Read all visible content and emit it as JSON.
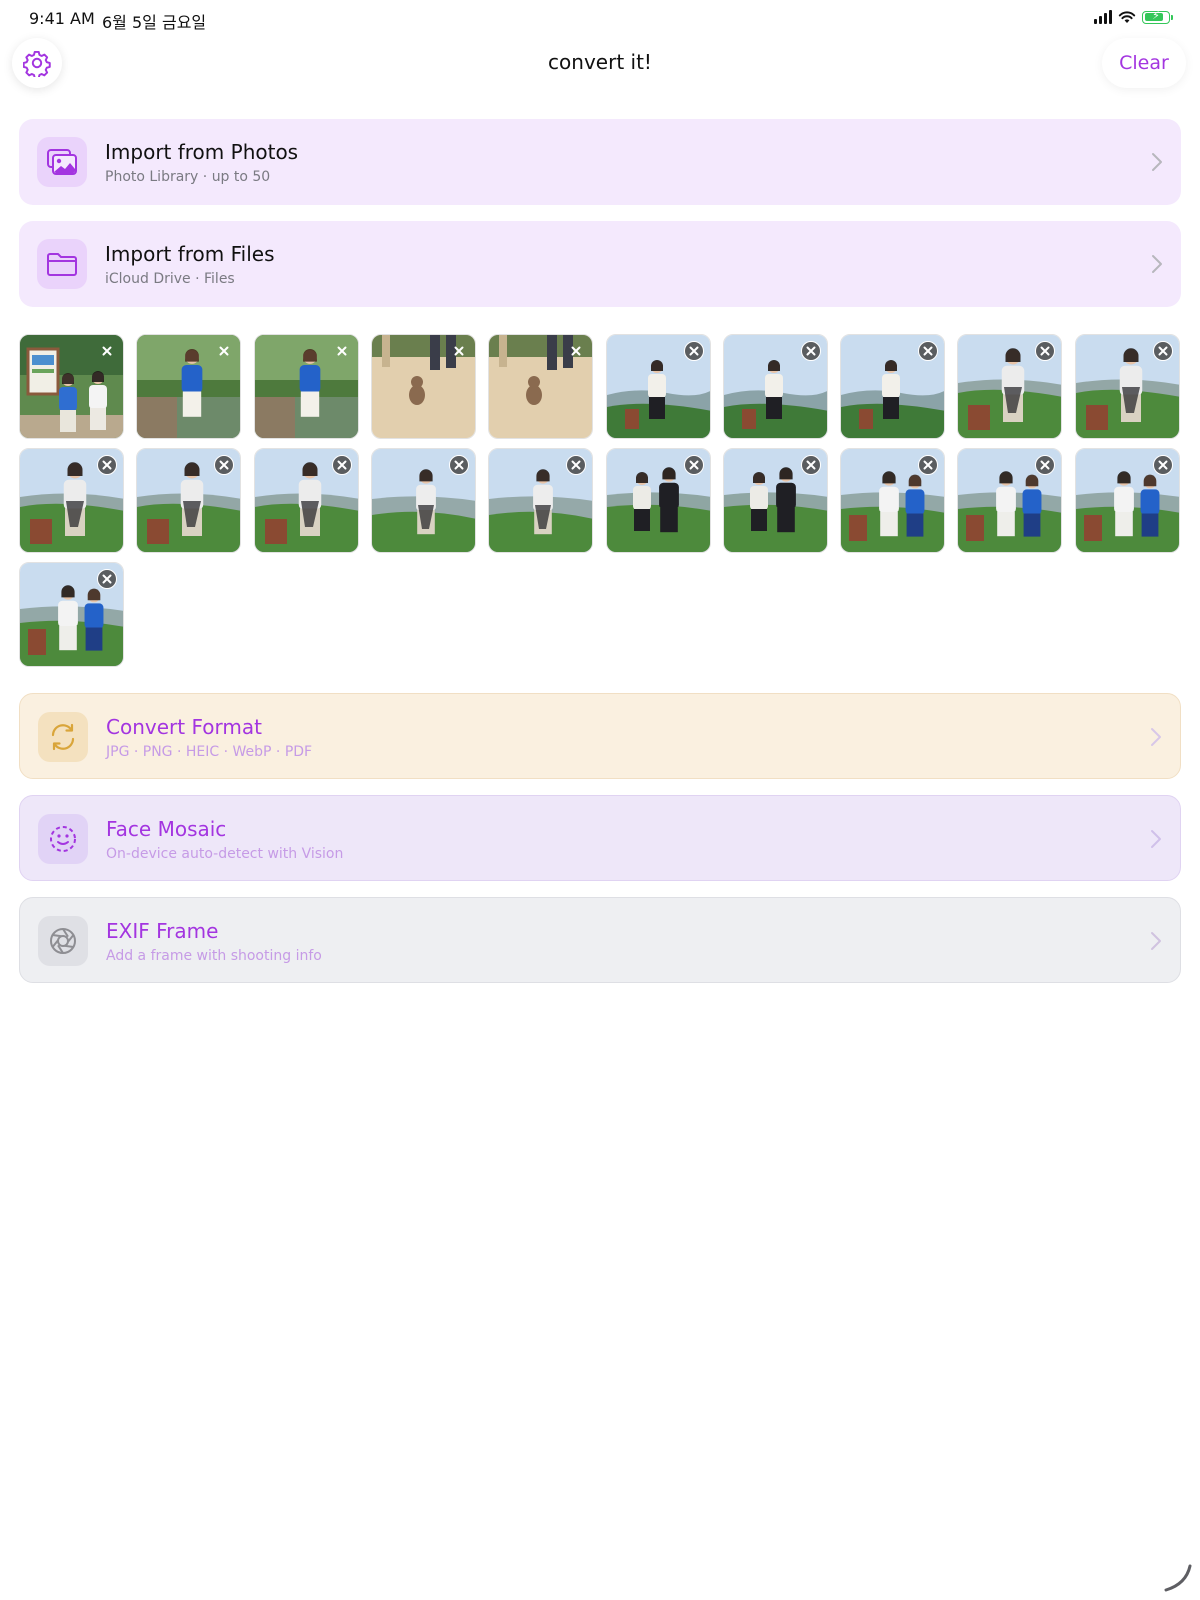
{
  "status_bar": {
    "time": "9:41 AM",
    "date": "6월 5일 금요일",
    "battery_level": 0.8,
    "icons": [
      "signal-icon",
      "wifi-icon",
      "battery-charging-icon"
    ]
  },
  "nav": {
    "title": "convert it!",
    "clear_label": "Clear",
    "settings_icon": "gear-icon"
  },
  "import_options": [
    {
      "title": "Import from Photos",
      "subtitle": "Photo Library · up to 50",
      "icon": "photos-icon"
    },
    {
      "title": "Import from Files",
      "subtitle": "iCloud Drive · Files",
      "icon": "folder-icon"
    }
  ],
  "photos": {
    "count": 21,
    "items": [
      {
        "scene": "park-sign",
        "remove_style": "plain"
      },
      {
        "scene": "pond",
        "remove_style": "plain"
      },
      {
        "scene": "pond",
        "remove_style": "plain"
      },
      {
        "scene": "monkey",
        "remove_style": "plain"
      },
      {
        "scene": "monkey",
        "remove_style": "plain"
      },
      {
        "scene": "viewpoint-back",
        "remove_style": "badge"
      },
      {
        "scene": "viewpoint-back",
        "remove_style": "badge"
      },
      {
        "scene": "viewpoint-back",
        "remove_style": "badge"
      },
      {
        "scene": "selfie",
        "remove_style": "badge"
      },
      {
        "scene": "selfie",
        "remove_style": "badge"
      },
      {
        "scene": "selfie",
        "remove_style": "badge"
      },
      {
        "scene": "selfie",
        "remove_style": "badge"
      },
      {
        "scene": "selfie",
        "remove_style": "badge"
      },
      {
        "scene": "selfie-wide",
        "remove_style": "badge"
      },
      {
        "scene": "selfie-wide",
        "remove_style": "badge"
      },
      {
        "scene": "couple-dark",
        "remove_style": "badge"
      },
      {
        "scene": "couple-dark",
        "remove_style": "badge"
      },
      {
        "scene": "couple",
        "remove_style": "badge"
      },
      {
        "scene": "couple",
        "remove_style": "badge"
      },
      {
        "scene": "couple",
        "remove_style": "badge"
      },
      {
        "scene": "couple",
        "remove_style": "badge"
      }
    ]
  },
  "actions": [
    {
      "title": "Convert Format",
      "subtitle": "JPG · PNG · HEIC · WebP · PDF",
      "icon": "convert-arrows-icon"
    },
    {
      "title": "Face Mosaic",
      "subtitle": "On-device auto-detect with Vision",
      "icon": "face-dashed-icon"
    },
    {
      "title": "EXIF Frame",
      "subtitle": "Add a frame with shooting info",
      "icon": "camera-aperture-icon"
    }
  ],
  "colors": {
    "accent": "#a335e0",
    "import_card_bg": "#f4e9fd",
    "convert_card_bg": "#faf0e0",
    "convert_icon": "#d9a53a",
    "face_card_bg": "#eee7f9",
    "exif_card_bg": "#eeeff2",
    "exif_icon": "#8e8e93"
  }
}
